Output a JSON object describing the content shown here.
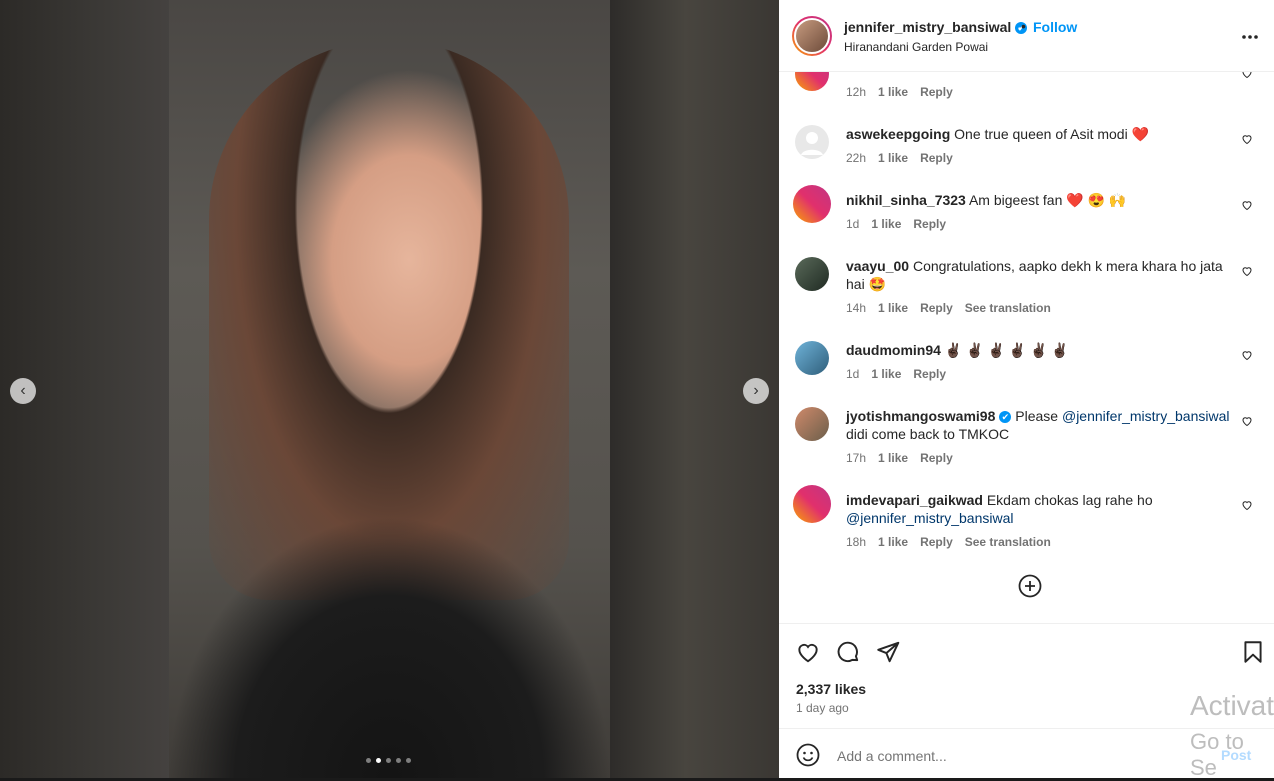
{
  "header": {
    "username": "jennifer_mistry_bansiwal",
    "separator": "•",
    "follow_label": "Follow",
    "location": "Hiranandani Garden Powai",
    "more_icon": "more-icon",
    "verified_icon": "✔"
  },
  "carousel": {
    "prev_icon": "‹",
    "next_icon": "›",
    "total_slides": 5,
    "active_slide": 2
  },
  "comments": [
    {
      "user": "",
      "text": "♥ ♥ ♥ ♥",
      "time": "12h",
      "likes": "1 like",
      "reply": "Reply",
      "translation": ""
    },
    {
      "user": "aswekeepgoing",
      "text": "One true queen of Asit modi ❤️",
      "time": "22h",
      "likes": "1 like",
      "reply": "Reply",
      "translation": ""
    },
    {
      "user": "nikhil_sinha_7323",
      "text": "Am bigeest fan ❤️ 😍 🙌",
      "time": "1d",
      "likes": "1 like",
      "reply": "Reply",
      "translation": ""
    },
    {
      "user": "vaayu_00",
      "text": "Congratulations, aapko dekh k mera khara ho jata hai 🤩",
      "time": "14h",
      "likes": "1 like",
      "reply": "Reply",
      "translation": "See translation"
    },
    {
      "user": "daudmomin94",
      "text": "✌🏿 ✌🏿 ✌🏿 ✌🏿 ✌🏿 ✌🏿",
      "time": "1d",
      "likes": "1 like",
      "reply": "Reply",
      "translation": ""
    },
    {
      "user": "jyotishmangoswami98",
      "text_before": "Please ",
      "mention": "@jennifer_mistry_bansiwal",
      "text_after": " didi come back to TMKOC",
      "time": "17h",
      "likes": "1 like",
      "reply": "Reply",
      "translation": ""
    },
    {
      "user": "imdevapari_gaikwad",
      "text_before": "Ekdam chokas lag rahe ho ",
      "mention": "@jennifer_mistry_bansiwal",
      "text_after": "",
      "time": "18h",
      "likes": "1 like",
      "reply": "Reply",
      "translation": "See translation"
    }
  ],
  "actions": {
    "likes": "2,337 likes",
    "posted": "1 day ago"
  },
  "composer": {
    "placeholder": "Add a comment...",
    "post_label": "Post"
  },
  "watermark": {
    "line1": "Activat",
    "line2": "Go to Se"
  },
  "colors": {
    "accent": "#0095f6",
    "mention": "#00376b",
    "muted": "#737373"
  }
}
